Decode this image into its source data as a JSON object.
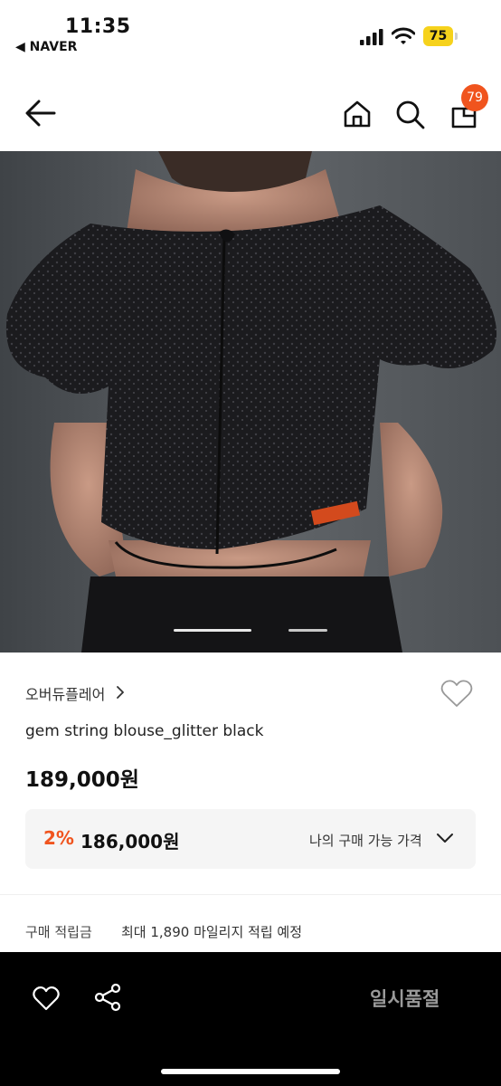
{
  "status_bar": {
    "time": "11:35",
    "back_app": "◀ NAVER",
    "battery": "75"
  },
  "nav": {
    "cart_count": "79"
  },
  "product": {
    "brand": "오버듀플레어",
    "title": "gem string blouse_glitter black",
    "price": "189,000원",
    "image_count": 2,
    "current_image": 1
  },
  "benefit": {
    "discount_rate": "2%",
    "discount_price": "186,000원",
    "label": "나의 구매 가능 가격"
  },
  "points": {
    "label": "구매 적립금",
    "value": "최대 1,890 마일리지 적립 예정"
  },
  "bottom_bar": {
    "status": "일시품절"
  },
  "colors": {
    "accent": "#f0541e",
    "battery": "#f6d21c",
    "bar_bg": "#000000",
    "soldout_text": "#9a9a9a"
  },
  "icons": [
    "arrow-left-icon",
    "home-icon",
    "search-icon",
    "shopping-bag-icon",
    "heart-icon",
    "chevron-right-icon",
    "chevron-down-icon",
    "share-icon"
  ]
}
